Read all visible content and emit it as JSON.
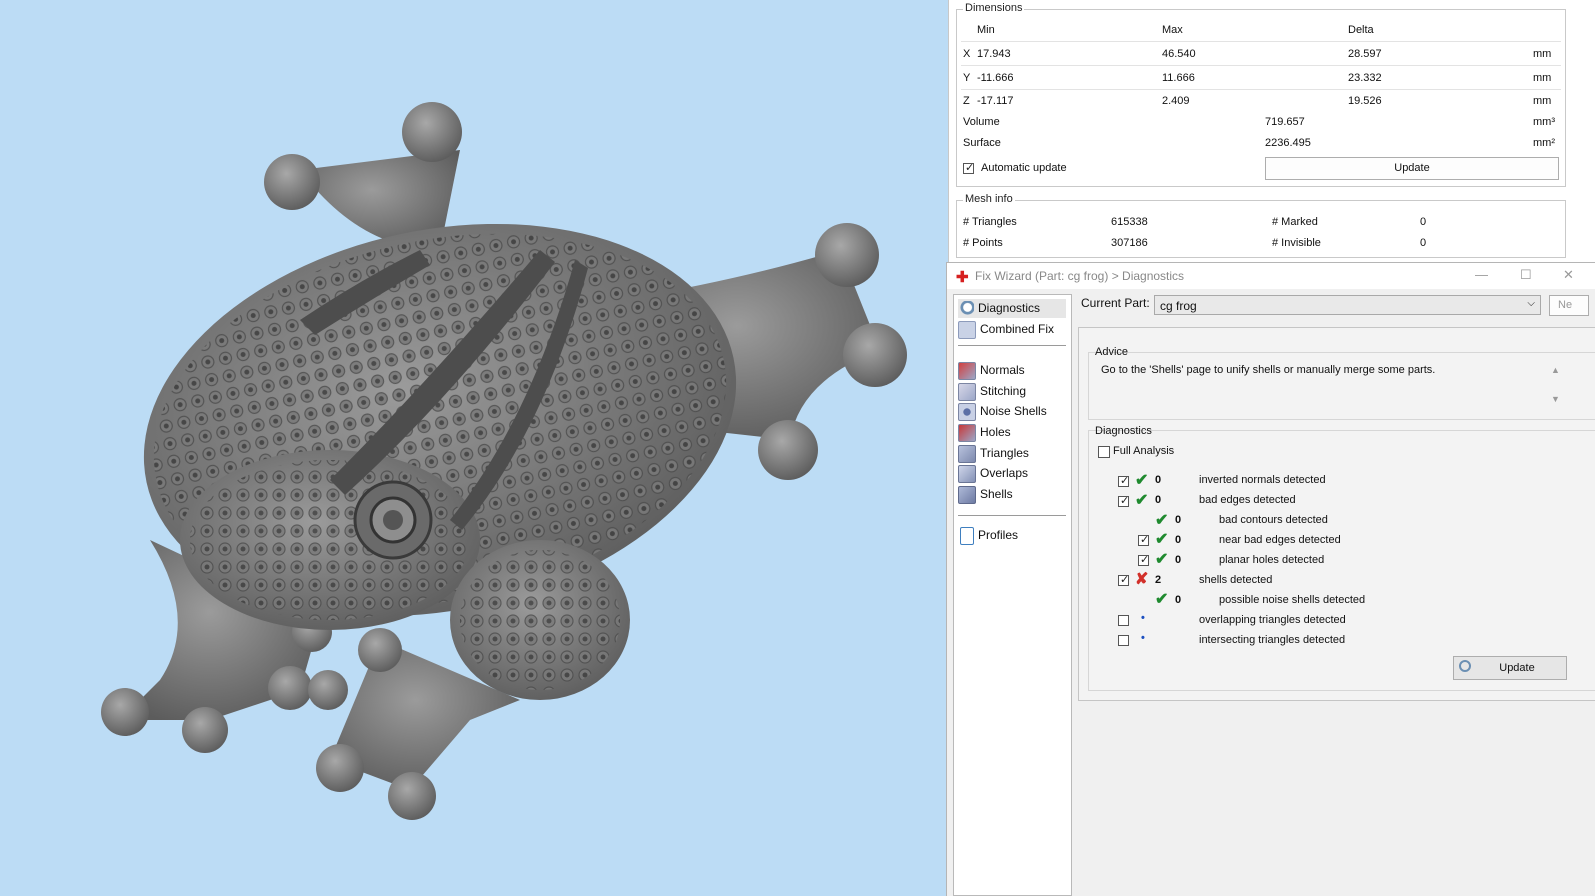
{
  "dimensions": {
    "title": "Dimensions",
    "headers": [
      "Min",
      "Max",
      "Delta"
    ],
    "rows": [
      {
        "axis": "X",
        "min": "17.943",
        "max": "46.540",
        "delta": "28.597",
        "unit": "mm"
      },
      {
        "axis": "Y",
        "min": "-11.666",
        "max": "11.666",
        "delta": "23.332",
        "unit": "mm"
      },
      {
        "axis": "Z",
        "min": "-17.117",
        "max": "2.409",
        "delta": "19.526",
        "unit": "mm"
      }
    ],
    "volume_label": "Volume",
    "volume_value": "719.657",
    "volume_unit": "mm³",
    "surface_label": "Surface",
    "surface_value": "2236.495",
    "surface_unit": "mm²",
    "auto_update_label": "Automatic update",
    "update_button": "Update"
  },
  "mesh_info": {
    "title": "Mesh info",
    "triangles_label": "# Triangles",
    "triangles_value": "615338",
    "points_label": "# Points",
    "points_value": "307186",
    "marked_label": "# Marked",
    "marked_value": "0",
    "invisible_label": "# Invisible",
    "invisible_value": "0"
  },
  "wizard": {
    "title": "Fix Wizard (Part: cg frog) > Diagnostics",
    "nav": [
      {
        "label": "Diagnostics",
        "icon": "magnifier-icon"
      },
      {
        "label": "Combined Fix",
        "icon": "cube-icon"
      },
      {
        "label": "Normals",
        "icon": "normals-cube-icon"
      },
      {
        "label": "Stitching",
        "icon": "stitching-cube-icon"
      },
      {
        "label": "Noise Shells",
        "icon": "noise-shells-icon"
      },
      {
        "label": "Holes",
        "icon": "holes-cube-icon"
      },
      {
        "label": "Triangles",
        "icon": "triangles-cube-icon"
      },
      {
        "label": "Overlaps",
        "icon": "overlaps-cube-icon"
      },
      {
        "label": "Shells",
        "icon": "shells-cube-icon"
      },
      {
        "label": "Profiles",
        "icon": "document-icon"
      }
    ],
    "current_part_label": "Current Part:",
    "current_part_value": "cg frog",
    "next_button": "Ne",
    "advice_title": "Advice",
    "advice_text": "Go to the 'Shells' page to unify shells or manually merge some parts.",
    "diagnostics_title": "Diagnostics",
    "full_analysis_label": "Full Analysis",
    "diagnostics": [
      {
        "count": "0",
        "label": "inverted normals detected"
      },
      {
        "count": "0",
        "label": "bad edges detected"
      },
      {
        "count": "0",
        "label": "bad contours detected"
      },
      {
        "count": "0",
        "label": "near bad edges detected"
      },
      {
        "count": "0",
        "label": "planar holes detected"
      },
      {
        "count": "2",
        "label": "shells detected"
      },
      {
        "count": "0",
        "label": "possible noise shells detected"
      },
      {
        "count": "",
        "label": "overlapping triangles detected"
      },
      {
        "count": "",
        "label": "intersecting triangles detected"
      }
    ],
    "update_button": "Update"
  },
  "colors": {
    "viewport_bg": "#bcdcf5",
    "model_gray": "#8a8a8a",
    "ok_green": "#1f8a2f",
    "error_red": "#d2302a"
  }
}
